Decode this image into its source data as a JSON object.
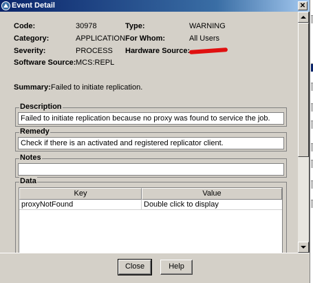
{
  "window": {
    "title": "Event Detail",
    "close_glyph": "✕"
  },
  "fields": {
    "code": {
      "label": "Code:",
      "value": "30978"
    },
    "type": {
      "label": "Type:",
      "value": "WARNING"
    },
    "category": {
      "label": "Category:",
      "value": "APPLICATION"
    },
    "for_whom": {
      "label": "For Whom:",
      "value": "All Users"
    },
    "severity": {
      "label": "Severity:",
      "value": "PROCESS"
    },
    "hardware_source": {
      "label": "Hardware Source:",
      "value_redacted": true
    },
    "software_source": {
      "label": "Software Source:",
      "value": "MCS:REPL"
    },
    "summary": {
      "label": "Summary:",
      "value": "Failed to initiate replication."
    }
  },
  "groups": {
    "description": {
      "title": "Description",
      "value": "Failed to initiate replication because no proxy was found to service the job."
    },
    "remedy": {
      "title": "Remedy",
      "value": "Check if there is an activated and registered replicator client."
    },
    "notes": {
      "title": "Notes",
      "value": ""
    },
    "data": {
      "title": "Data",
      "columns": [
        "Key",
        "Value"
      ],
      "rows": [
        {
          "key": "proxyNotFound",
          "value": "Double click to display"
        }
      ]
    }
  },
  "buttons": {
    "close": "Close",
    "help": "Help"
  },
  "icons": {
    "title": "app-icon",
    "scroll_up": "arrow-up-icon",
    "scroll_down": "arrow-down-icon"
  },
  "colors": {
    "titlebar": "#0a246a",
    "dialog_bg": "#d4d0c8",
    "redaction": "#e01010"
  }
}
